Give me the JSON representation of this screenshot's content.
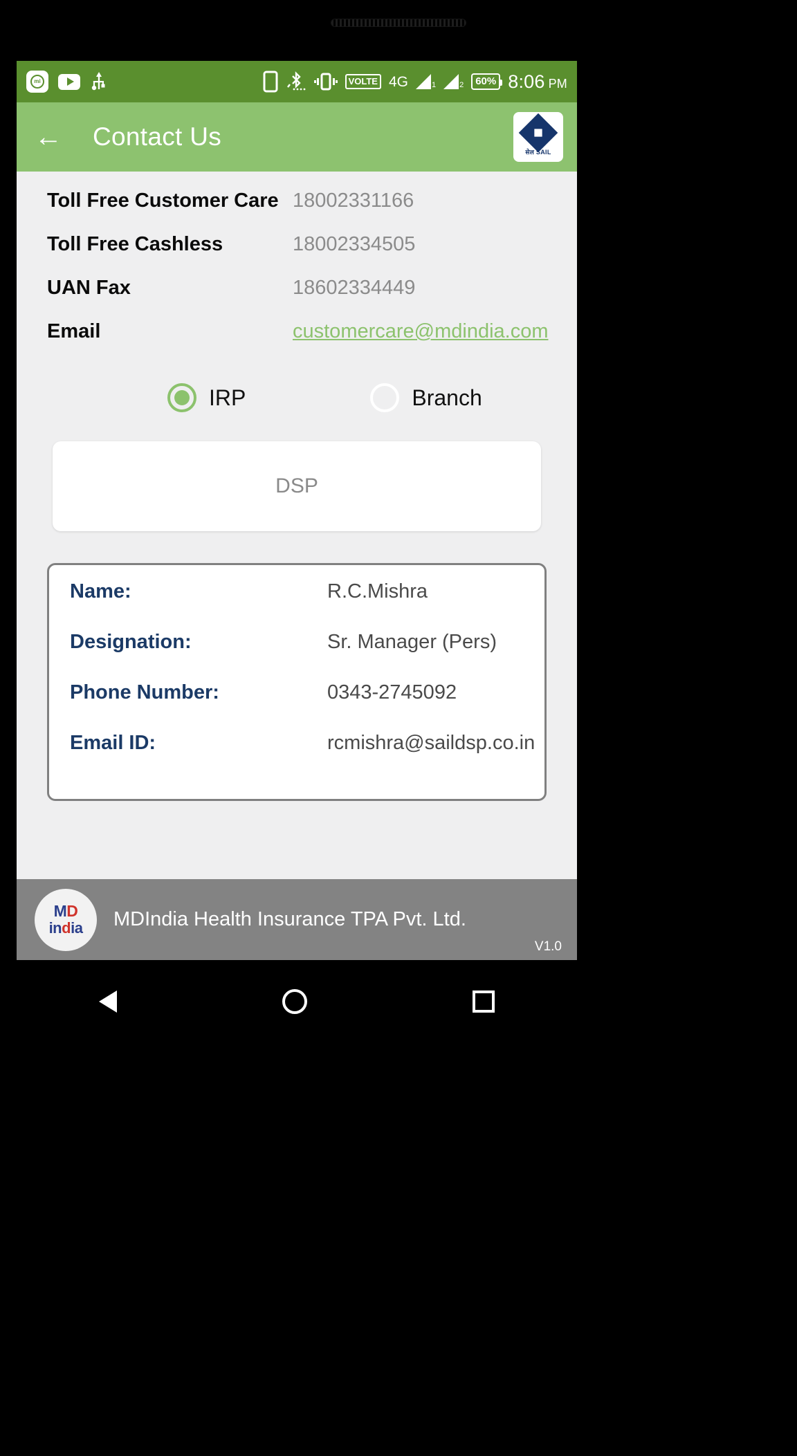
{
  "statusbar": {
    "icons_left": [
      "mi-app-icon",
      "youtube-icon",
      "usb-icon"
    ],
    "icons_right": [
      "sim-card-icon",
      "bluetooth-icon",
      "vibrate-icon",
      "volte-icon",
      "network-4g-icon",
      "signal-1-icon",
      "signal-2-icon"
    ],
    "volte_label": "VOLTE",
    "network_label": "4G",
    "sim1_label": "1",
    "sim2_label": "2",
    "battery_label": "60%",
    "time": "8:06",
    "meridiem": "PM"
  },
  "appbar": {
    "back_icon": "back-arrow-icon",
    "title": "Contact Us",
    "logo_text": "सेल SAIL"
  },
  "contact_info": [
    {
      "label": "Toll Free Customer Care",
      "value": "18002331166",
      "is_link": false
    },
    {
      "label": "Toll Free Cashless",
      "value": "18002334505",
      "is_link": false
    },
    {
      "label": "UAN Fax",
      "value": "18602334449",
      "is_link": false
    },
    {
      "label": "Email",
      "value": "customercare@mdindia.com",
      "is_link": true
    }
  ],
  "radio_group": {
    "options": [
      {
        "label": "IRP",
        "selected": true
      },
      {
        "label": "Branch",
        "selected": false
      }
    ]
  },
  "spinner": {
    "selected": "DSP"
  },
  "details": [
    {
      "label": "Name:",
      "value": "R.C.Mishra"
    },
    {
      "label": "Designation:",
      "value": "Sr. Manager (Pers)"
    },
    {
      "label": "Phone Number:",
      "value": "0343-2745092"
    },
    {
      "label": "Email ID:",
      "value": "rcmishra@saildsp.co.in"
    }
  ],
  "footer": {
    "logo_md": "MD",
    "logo_india": "india",
    "company": "MDIndia Health Insurance TPA Pvt. Ltd.",
    "version": "V1.0"
  },
  "navbar": {
    "back": "nav-back-icon",
    "home": "nav-home-icon",
    "recents": "nav-recents-icon"
  },
  "colors": {
    "statusbar_green": "#5a8f2e",
    "appbar_green": "#8dc26f",
    "link_green": "#8cc26d",
    "page_bg": "#efeff0",
    "label_navy": "#1b3a66",
    "footer_gray": "#838383"
  }
}
